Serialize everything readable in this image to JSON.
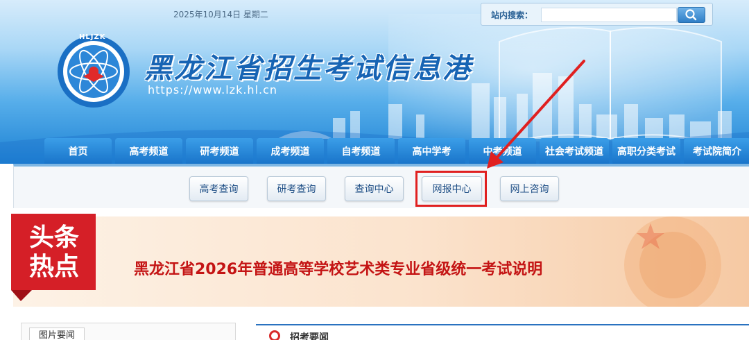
{
  "header": {
    "date": "2025年10月14日 星期二",
    "site_title": "黑龙江省招生考试信息港",
    "site_url": "https://www.lzk.hl.cn",
    "logo_text": "HLJZK",
    "logo_subtext": "黑龙江招生考试信息港"
  },
  "search": {
    "label": "站内搜索：",
    "value": "",
    "button_icon": "search-icon"
  },
  "nav": {
    "tabs": [
      {
        "label": "首页"
      },
      {
        "label": "高考频道"
      },
      {
        "label": "研考频道"
      },
      {
        "label": "成考频道"
      },
      {
        "label": "自考频道"
      },
      {
        "label": "高中学考"
      },
      {
        "label": "中考频道"
      },
      {
        "label": "社会考试频道"
      },
      {
        "label": "高职分类考试"
      },
      {
        "label": "考试院简介"
      }
    ]
  },
  "subnav": {
    "buttons": [
      {
        "label": "高考查询"
      },
      {
        "label": "研考查询"
      },
      {
        "label": "查询中心"
      },
      {
        "label": "网报中心",
        "highlighted": true
      },
      {
        "label": "网上咨询"
      }
    ]
  },
  "headline": {
    "badge_lines": [
      "头条",
      "热点"
    ],
    "text": "黑龙江省2026年普通高等学校艺术类专业省级统一考试说明"
  },
  "panels": {
    "left_tab": "图片要闻",
    "right_title": "招考要闻"
  },
  "colors": {
    "nav_blue": "#1873c9",
    "highlight_red": "#e02020",
    "headline_red": "#c41414"
  }
}
